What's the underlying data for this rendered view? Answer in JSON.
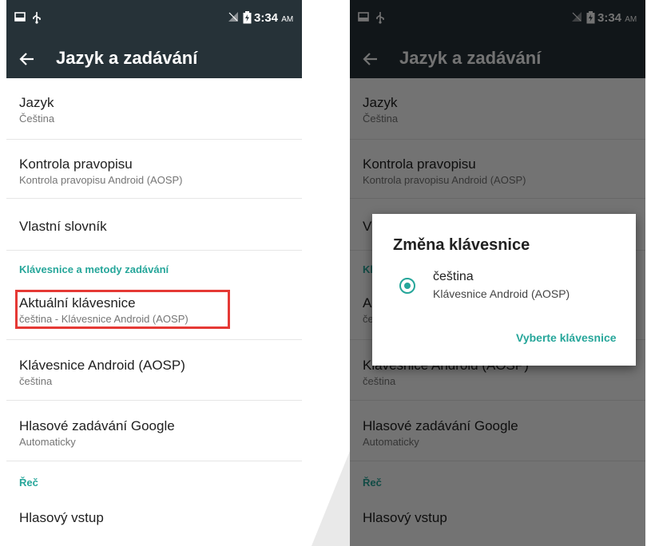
{
  "status_bar": {
    "time": "3:34",
    "ampm": "AM",
    "icons": [
      "screenshot-icon",
      "usb-icon",
      "signal-muted-icon",
      "battery-icon"
    ]
  },
  "toolbar": {
    "title": "Jazyk a zadávání",
    "back_icon": "back-arrow-icon"
  },
  "settings": {
    "jazyk": {
      "title": "Jazyk",
      "subtitle": "Čeština"
    },
    "kontrola": {
      "title": "Kontrola pravopisu",
      "subtitle": "Kontrola pravopisu Android (AOSP)"
    },
    "slovnik": {
      "title": "Vlastní slovník"
    },
    "section_keyboards": "Klávesnice a metody zadávání",
    "aktualni": {
      "title": "Aktuální klávesnice",
      "subtitle": "čeština - Klávesnice Android (AOSP)"
    },
    "aosp": {
      "title": "Klávesnice Android (AOSP)",
      "subtitle": "čeština"
    },
    "google": {
      "title": "Hlasové zadávání Google",
      "subtitle": "Automaticky"
    },
    "section_speech": "Řeč",
    "vstup": {
      "title": "Hlasový vstup"
    }
  },
  "dialog": {
    "title": "Změna klávesnice",
    "option": {
      "title": "čeština",
      "subtitle": "Klávesnice Android (AOSP)",
      "selected": true
    },
    "action": "Vyberte klávesnice"
  },
  "colors": {
    "toolbar": "#263238",
    "accent": "#26a69a",
    "highlight": "#e53935"
  }
}
